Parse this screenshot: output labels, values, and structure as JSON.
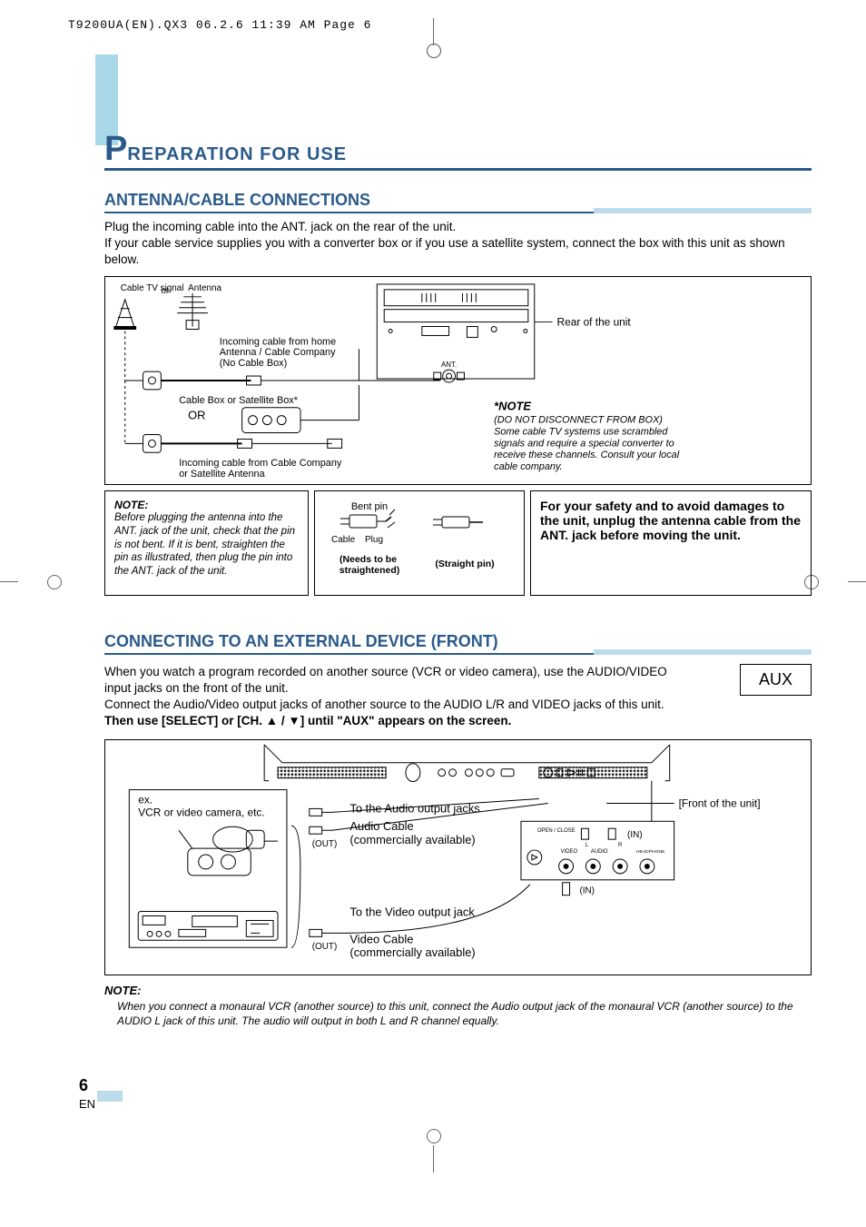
{
  "print_header": "T9200UA(EN).QX3  06.2.6  11:39 AM  Page 6",
  "main_title_big": "P",
  "main_title_rest": "REPARATION FOR USE",
  "section1": {
    "title": "ANTENNA/CABLE CONNECTIONS",
    "intro1": "Plug the incoming cable into the ANT. jack on the rear of the unit.",
    "intro2": "If your cable service supplies you with a converter box or if you use a satellite system, connect the box with this unit as shown below.",
    "labels": {
      "cable_tv_signal": "Cable TV signal",
      "or_small": "or",
      "antenna": "Antenna",
      "incoming_home": "Incoming cable from home Antenna / Cable Company (No Cable Box)",
      "cable_box": "Cable Box or Satellite Box*",
      "or_big": "OR",
      "incoming_company": "Incoming cable from Cable Company or Satellite Antenna",
      "rear": "Rear of the unit",
      "ant": "ANT.",
      "note_title": "*NOTE",
      "note_body": "(DO NOT DISCONNECT FROM BOX) Some cable TV systems use scrambled signals and require a special converter to receive these channels. Consult your local cable company."
    }
  },
  "note_row": {
    "n1_title": "NOTE:",
    "n1_body": "Before plugging the antenna into the ANT. jack of the unit, check that the pin is not bent. If it is bent, straighten the pin as illustrated, then plug the pin into the ANT. jack of the unit.",
    "n2_bent": "Bent pin",
    "n2_cable": "Cable",
    "n2_plug": "Plug",
    "n2_needs": "(Needs to be straightened)",
    "n2_straight": "(Straight pin)",
    "n3_body": "For your safety and to avoid damages to the unit, unplug the antenna cable from the ANT. jack before moving the unit."
  },
  "section2": {
    "title": "CONNECTING TO AN EXTERNAL DEVICE (FRONT)",
    "p1": "When you watch a program recorded on another source (VCR or video camera), use the AUDIO/VIDEO input jacks on the front of the unit.",
    "p2": "Connect the Audio/Video output jacks of another source to the AUDIO L/R and VIDEO jacks of this unit.",
    "p3a": "Then use [SELECT] or [CH. ",
    "p3b": " / ",
    "p3c": "] until \"AUX\" appears on the screen.",
    "aux": "AUX",
    "labels": {
      "ex": "ex.",
      "vcr": "VCR or video camera, etc.",
      "to_audio": "To the Audio output jacks",
      "audio_cable": "Audio Cable",
      "comm_avail": "(commercially available)",
      "to_video": "To the Video output jack",
      "video_cable": "Video Cable",
      "out": "(OUT)",
      "in": "(IN)",
      "front": "[Front of the unit]",
      "open_close": "OPEN / CLOSE",
      "video": "VIDEO",
      "audio": "AUDIO",
      "headphone": "HEADPHONE",
      "l": "L",
      "r": "R"
    },
    "note_title": "NOTE:",
    "note_body": "When you connect a monaural VCR (another source) to this unit, connect the Audio output jack of the monaural VCR (another source) to the AUDIO L jack of this unit. The audio will output in both L and R channel equally."
  },
  "page_num": "6",
  "page_lang": "EN"
}
